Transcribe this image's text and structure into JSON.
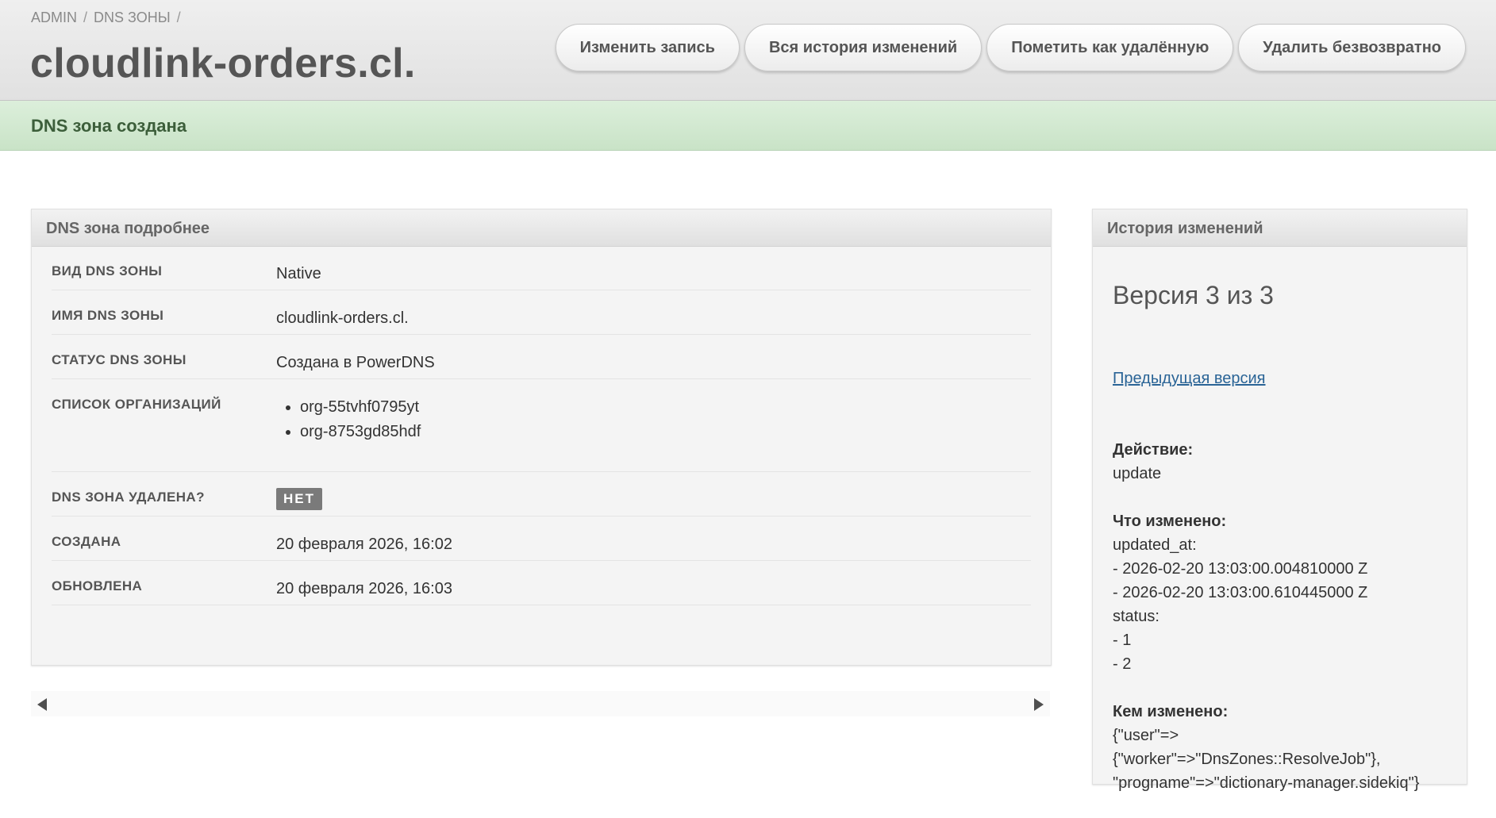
{
  "breadcrumb": {
    "items": [
      "ADMIN",
      "DNS ЗОНЫ"
    ],
    "separator": "/"
  },
  "page": {
    "title": "cloudlink-orders.cl."
  },
  "actions": {
    "edit": "Изменить запись",
    "history": "Вся история изменений",
    "mark_deleted": "Пометить как удалённую",
    "delete": "Удалить безвозвратно"
  },
  "flash": {
    "message": "DNS зона создана"
  },
  "details": {
    "heading": "DNS зона подробнее",
    "kind": {
      "label": "Вид DNS зоны",
      "value": "Native"
    },
    "name": {
      "label": "Имя DNS зоны",
      "value": "cloudlink-orders.cl."
    },
    "status": {
      "label": "Статус DNS зоны",
      "value": "Создана в PowerDNS"
    },
    "orgs": {
      "label": "Список организаций",
      "items": [
        "org-55tvhf0795yt",
        "org-8753gd85hdf"
      ]
    },
    "deleted": {
      "label": "DNS зона удалена?",
      "value": "НЕТ"
    },
    "created": {
      "label": "Создана",
      "value": "20 февраля 2026, 16:02"
    },
    "updated": {
      "label": "Обновлена",
      "value": "20 февраля 2026, 16:03"
    }
  },
  "history": {
    "heading": "История изменений",
    "version": "Версия 3 из 3",
    "prev_link": "Предыдущая версия",
    "action_label": "Действие:",
    "action_value": "update",
    "changed_label": "Что изменено:",
    "changes": [
      "updated_at:",
      "- 2026-02-20 13:03:00.004810000 Z",
      "- 2026-02-20 13:03:00.610445000 Z",
      "status:",
      "- 1",
      "- 2"
    ],
    "by_label": "Кем изменено:",
    "by_lines": [
      "{\"user\"=>",
      "{\"worker\"=>\"DnsZones::ResolveJob\"},",
      "\"progname\"=>\"dictionary-manager.sidekiq\"}"
    ]
  },
  "icons": {
    "scroll_left": "triangle-left-icon",
    "scroll_right": "triangle-right-icon"
  }
}
